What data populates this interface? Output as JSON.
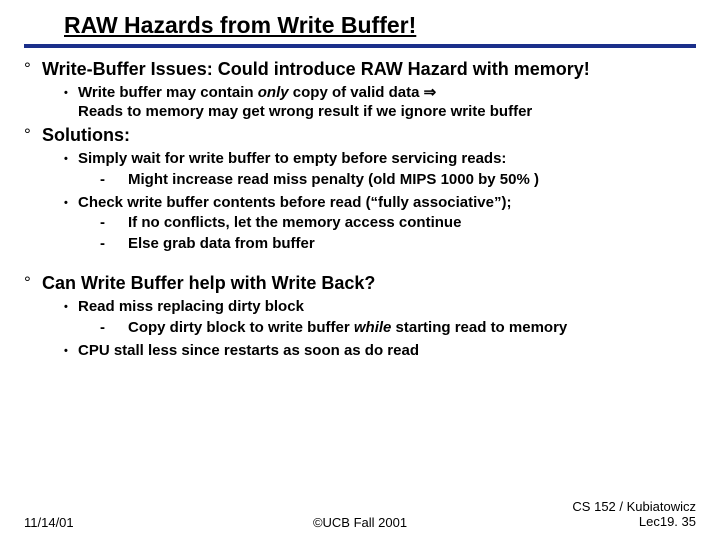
{
  "title": "RAW Hazards from Write Buffer!",
  "p1": {
    "head": "Write-Buffer Issues: Could introduce RAW Hazard with memory!",
    "b1a": "Write buffer may contain ",
    "b1em": "only",
    "b1b": " copy of valid data ",
    "b1arrow": "⇒",
    "b1c": "Reads to memory may get wrong result if we ignore write buffer"
  },
  "p2": {
    "head": "Solutions:",
    "b1": "Simply wait for write buffer to empty before servicing reads:",
    "b1d1": "Might increase read miss penalty (old MIPS 1000 by 50% )",
    "b2": "Check write buffer contents before read (“fully associative”);",
    "b2d1": "If no conflicts, let the memory access continue",
    "b2d2": "Else grab data from buffer"
  },
  "p3": {
    "head": "Can Write Buffer help with Write Back?",
    "b1": "Read miss replacing dirty block",
    "b1d1a": "Copy dirty block to write buffer ",
    "b1d1em": "while",
    "b1d1b": " starting read to memory",
    "b2": "CPU stall less since restarts as soon as do read"
  },
  "footer": {
    "date": "11/14/01",
    "center": "©UCB Fall 2001",
    "right1": "CS 152 / Kubiatowicz",
    "right2": "Lec19. 35"
  }
}
